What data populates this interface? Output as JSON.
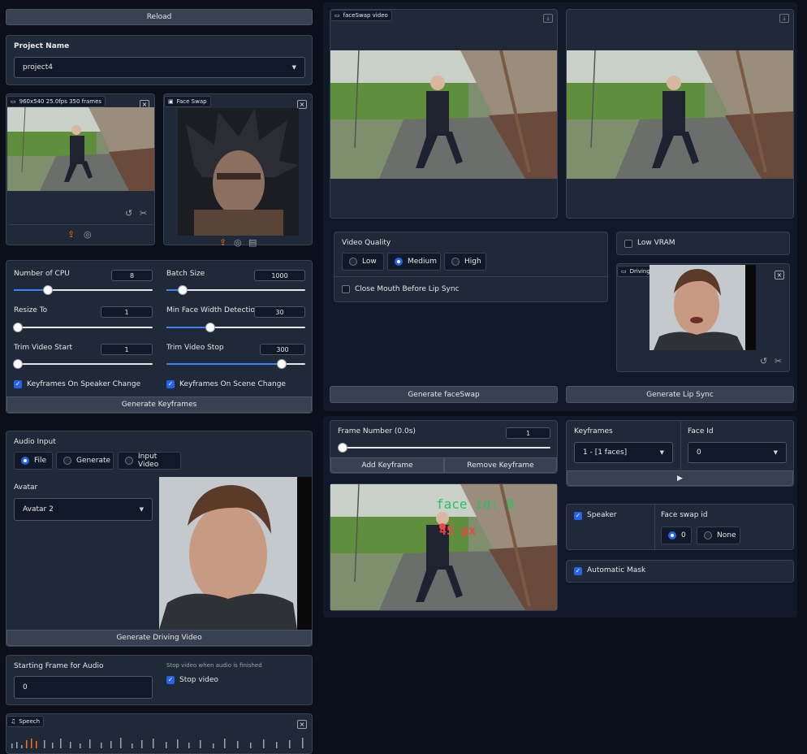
{
  "reload": "Reload",
  "project": {
    "label": "Project Name",
    "value": "project4"
  },
  "video_info_tag": "960x540 25.0fps 350 frames",
  "face_swap_tag": "Face Swap",
  "sliders": {
    "cpu": {
      "label": "Number of CPU",
      "value": "8",
      "level": 0.3
    },
    "batch": {
      "label": "Batch Size",
      "value": "1000",
      "level": 0.12
    },
    "resize": {
      "label": "Resize To",
      "value": "1",
      "level": 0.0
    },
    "minface": {
      "label": "Min Face Width Detection",
      "value": "30",
      "level": 0.32
    },
    "trimstart": {
      "label": "Trim Video Start",
      "value": "1",
      "level": 0.0
    },
    "trimstop": {
      "label": "Trim Video Stop",
      "value": "300",
      "level": 0.83
    }
  },
  "kf_speaker": "Keyframes On Speaker Change",
  "kf_scene": "Keyframes On Scene Change",
  "generate_keyframes": "Generate Keyframes",
  "audio": {
    "label": "Audio Input",
    "options": [
      "File",
      "Generate",
      "Input Video"
    ],
    "selected": "File"
  },
  "avatar": {
    "label": "Avatar",
    "value": "Avatar 2"
  },
  "generate_driving": "Generate Driving Video",
  "start_frame": {
    "label": "Starting Frame for Audio",
    "value": "0"
  },
  "stop_hint": "Stop video when audio is finished",
  "stop_video": "Stop video",
  "speech_tag": "Speech",
  "faceswap_video_tag": "faceSwap video",
  "video_quality": {
    "label": "Video Quality",
    "options": [
      "Low",
      "Medium",
      "High"
    ],
    "selected": "Medium"
  },
  "close_mouth": "Close Mouth Before Lip Sync",
  "low_vram": "Low VRAM",
  "driving_video_tag": "Driving Video",
  "generate_faceswap": "Generate faceSwap",
  "generate_lipsync": "Generate Lip Sync",
  "frame_number": {
    "label": "Frame Number (0.0s)",
    "value": "1",
    "level": 0.0
  },
  "add_keyframe": "Add Keyframe",
  "remove_keyframe": "Remove Keyframe",
  "keyframes": {
    "label": "Keyframes",
    "value": "1 - [1 faces]"
  },
  "face_id": {
    "label": "Face Id",
    "value": "0"
  },
  "play_icon": "▶",
  "speaker": "Speaker",
  "face_swap_id": {
    "label": "Face swap id",
    "options": [
      "0",
      "None"
    ],
    "selected": "0"
  },
  "automatic_mask": "Automatic Mask",
  "overlay": {
    "face_id_text": "face id: 0",
    "px_text": "45 px"
  }
}
